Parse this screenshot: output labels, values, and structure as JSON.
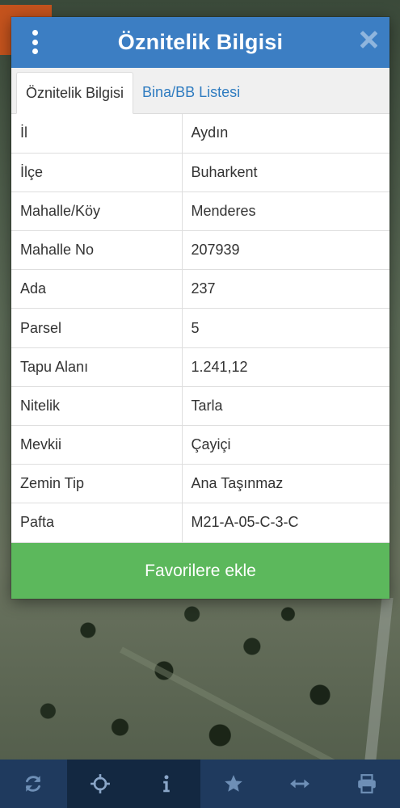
{
  "dialog": {
    "title": "Öznitelik Bilgisi",
    "tabs": [
      {
        "label": "Öznitelik Bilgisi",
        "active": true
      },
      {
        "label": "Bina/BB Listesi",
        "active": false
      }
    ],
    "rows": [
      {
        "key": "İl",
        "value": "Aydın"
      },
      {
        "key": "İlçe",
        "value": "Buharkent"
      },
      {
        "key": "Mahalle/Köy",
        "value": "Menderes"
      },
      {
        "key": "Mahalle No",
        "value": "207939"
      },
      {
        "key": "Ada",
        "value": "237"
      },
      {
        "key": "Parsel",
        "value": "5"
      },
      {
        "key": "Tapu Alanı",
        "value": "1.241,12"
      },
      {
        "key": "Nitelik",
        "value": "Tarla"
      },
      {
        "key": "Mevkii",
        "value": "Çayiçi"
      },
      {
        "key": "Zemin Tip",
        "value": "Ana Taşınmaz"
      },
      {
        "key": "Pafta",
        "value": "M21-A-05-C-3-C"
      }
    ],
    "favorite_label": "Favorilere ekle"
  },
  "toolbar": {
    "items": [
      {
        "icon": "refresh-icon",
        "active": false
      },
      {
        "icon": "locate-icon",
        "active": true
      },
      {
        "icon": "info-icon",
        "active": true
      },
      {
        "icon": "star-icon",
        "active": false
      },
      {
        "icon": "measure-icon",
        "active": false
      },
      {
        "icon": "print-icon",
        "active": false
      }
    ]
  },
  "colors": {
    "header": "#3c7ec3",
    "tab_link": "#2f7cc0",
    "favorite_button": "#5cb85c",
    "toolbar": "#1f3a5e",
    "toolbar_active": "#132841",
    "accent_tab": "#c5531d"
  }
}
